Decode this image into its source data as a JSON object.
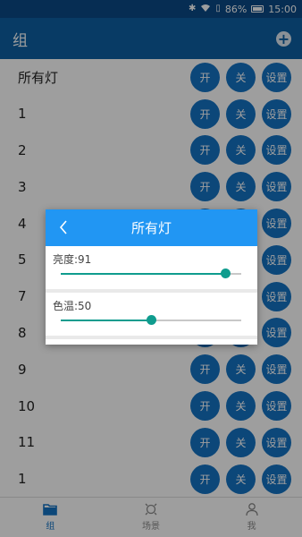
{
  "status_bar": {
    "battery": "86%",
    "time": "15:00"
  },
  "app_bar": {
    "title": "组",
    "add_icon": "plus-circle-icon"
  },
  "control_buttons": {
    "on": "开",
    "off": "关",
    "settings": "设置"
  },
  "groups": [
    {
      "label": "所有灯"
    },
    {
      "label": "1"
    },
    {
      "label": "2"
    },
    {
      "label": "3"
    },
    {
      "label": "4"
    },
    {
      "label": "5"
    },
    {
      "label": "7"
    },
    {
      "label": "8"
    },
    {
      "label": "9"
    },
    {
      "label": "10"
    },
    {
      "label": "11"
    },
    {
      "label": "1"
    }
  ],
  "dialog": {
    "title": "所有灯",
    "brightness_label": "亮度:91",
    "brightness_value": 91,
    "color_temp_label": "色温:50",
    "color_temp_value": 50
  },
  "bottom_nav": {
    "items": [
      {
        "label": "组",
        "icon": "folder-icon",
        "active": true
      },
      {
        "label": "场景",
        "icon": "scene-icon",
        "active": false
      },
      {
        "label": "我",
        "icon": "person-icon",
        "active": false
      }
    ]
  },
  "colors": {
    "app_bar": "#0d5fa3",
    "button": "#1473c4",
    "dialog_header": "#2196f3",
    "slider": "#0f9c8e"
  }
}
